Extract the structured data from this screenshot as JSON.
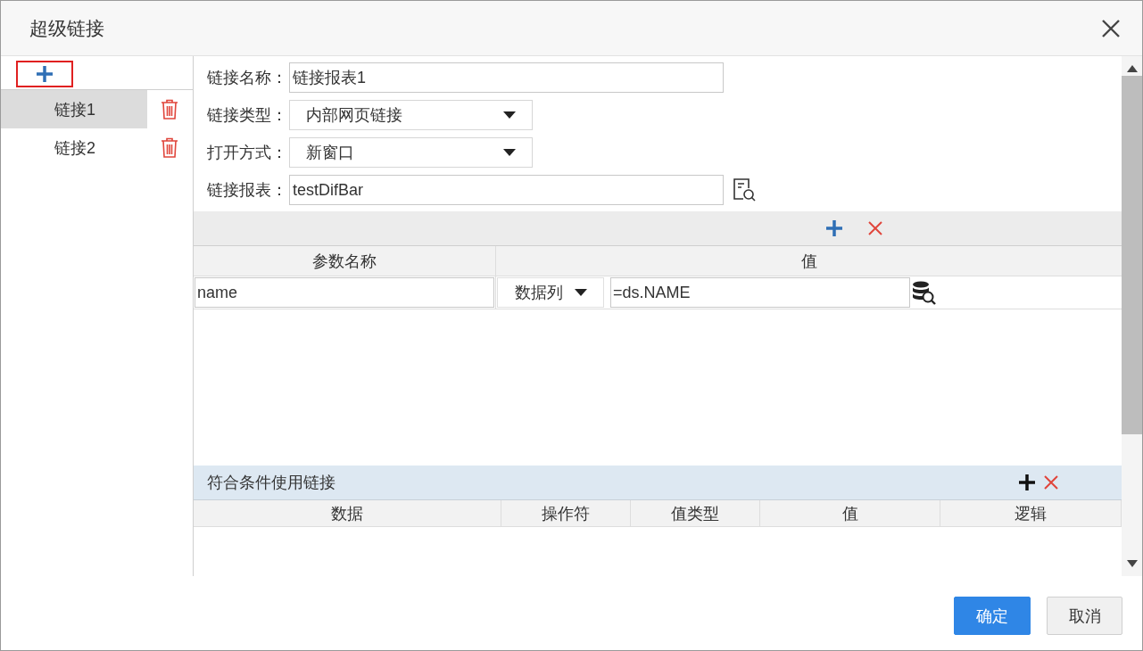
{
  "window": {
    "title": "超级链接"
  },
  "links": [
    {
      "label": "链接1",
      "selected": true
    },
    {
      "label": "链接2",
      "selected": false
    }
  ],
  "form": [
    {
      "kind": "text",
      "label": "链接名称：",
      "value": "链接报表1"
    },
    {
      "kind": "select",
      "label": "链接类型：",
      "value": "内部网页链接"
    },
    {
      "kind": "select",
      "label": "打开方式：",
      "value": "新窗口"
    },
    {
      "kind": "browse",
      "label": "链接报表：",
      "value": "testDifBar"
    }
  ],
  "params": {
    "columns": [
      "参数名称",
      "值"
    ],
    "rows": [
      {
        "name": "name",
        "type": "数据列",
        "value": "=ds.NAME"
      }
    ]
  },
  "conditions": {
    "title": "符合条件使用链接",
    "columns": [
      "数据",
      "操作符",
      "值类型",
      "值",
      "逻辑"
    ]
  },
  "buttons": [
    {
      "label": "确定",
      "kind": "primary"
    },
    {
      "label": "取消",
      "kind": "secondary"
    }
  ]
}
